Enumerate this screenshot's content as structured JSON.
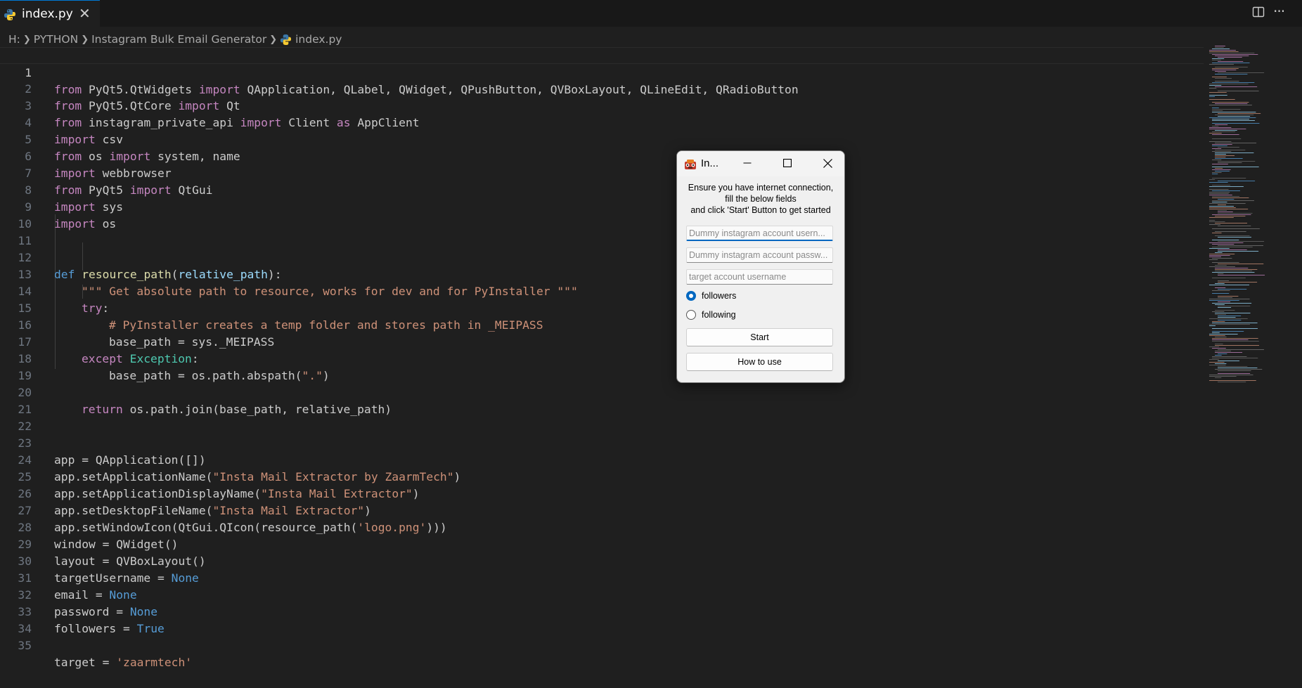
{
  "tab": {
    "filename": "index.py",
    "close_glyph": "✕"
  },
  "titlebar": {
    "split_icon": "split-editor-icon",
    "more_glyph": "···"
  },
  "breadcrumb": {
    "items": [
      "H:",
      "PYTHON",
      "Instagram Bulk Email Generator"
    ],
    "file": "index.py"
  },
  "editor": {
    "current_line": 1,
    "line_numbers": [
      "1",
      "2",
      "3",
      "4",
      "5",
      "6",
      "7",
      "8",
      "9",
      "10",
      "11",
      "12",
      "13",
      "14",
      "15",
      "16",
      "17",
      "18",
      "19",
      "20",
      "21",
      "22",
      "23",
      "24",
      "25",
      "26",
      "27",
      "28",
      "29",
      "30",
      "31",
      "32",
      "33",
      "34",
      "35"
    ]
  },
  "code": {
    "l1": {
      "kw1": "from",
      "t1": " PyQt5.QtWidgets ",
      "kw2": "import",
      "t2": " QApplication, QLabel, QWidget, QPushButton, QVBoxLayout, QLineEdit, QRadioButton"
    },
    "l2": {
      "kw1": "from",
      "t1": " PyQt5.QtCore ",
      "kw2": "import",
      "t2": " Qt"
    },
    "l3": {
      "kw1": "from",
      "t1": " instagram_private_api ",
      "kw2": "import",
      "t2": " Client ",
      "kw3": "as",
      "t3": " AppClient"
    },
    "l4": {
      "kw1": "import",
      "t1": " csv"
    },
    "l5": {
      "kw1": "from",
      "t1": " os ",
      "kw2": "import",
      "t2": " system, name"
    },
    "l6": {
      "kw1": "import",
      "t1": " webbrowser"
    },
    "l7": {
      "kw1": "from",
      "t1": " PyQt5 ",
      "kw2": "import",
      "t2": " QtGui"
    },
    "l8": {
      "kw1": "import",
      "t1": " sys"
    },
    "l9": {
      "kw1": "import",
      "t1": " os"
    },
    "l12": {
      "kw1": "def",
      "t0": " ",
      "fn": "resource_path",
      "t1": "(",
      "param": "relative_path",
      "t2": "):"
    },
    "l13": {
      "str": "\"\"\" Get absolute path to resource, works for dev and for PyInstaller \"\"\""
    },
    "l14": {
      "kw1": "try",
      "t1": ":"
    },
    "l15": {
      "cmt": "# PyInstaller creates a temp folder and stores path in _MEIPASS"
    },
    "l16": {
      "t1": "base_path = sys._MEIPASS"
    },
    "l17": {
      "kw1": "except",
      "t0": " ",
      "cls": "Exception",
      "t1": ":"
    },
    "l18": {
      "t1": "base_path = os.path.abspath(",
      "str": "\".\"",
      "t2": ")"
    },
    "l20": {
      "kw1": "return",
      "t1": " os.path.join(base_path, relative_path)"
    },
    "l23": {
      "t1": "app = QApplication([])"
    },
    "l24": {
      "t1": "app.setApplicationName(",
      "str": "\"Insta Mail Extractor by ZaarmTech\"",
      "t2": ")"
    },
    "l25": {
      "t1": "app.setApplicationDisplayName(",
      "str": "\"Insta Mail Extractor\"",
      "t2": ")"
    },
    "l26": {
      "t1": "app.setDesktopFileName(",
      "str": "\"Insta Mail Extractor\"",
      "t2": ")"
    },
    "l27": {
      "t1": "app.setWindowIcon(QtGui.QIcon(resource_path(",
      "str": "'logo.png'",
      "t2": ")))"
    },
    "l28": {
      "t1": "window = QWidget()"
    },
    "l29": {
      "t1": "layout = QVBoxLayout()"
    },
    "l30": {
      "t1": "targetUsername = ",
      "const": "None"
    },
    "l31": {
      "t1": "email = ",
      "const": "None"
    },
    "l32": {
      "t1": "password = ",
      "const": "None"
    },
    "l33": {
      "t1": "followers = ",
      "const": "True"
    },
    "l35": {
      "t1": "target = ",
      "str": "'zaarmtech'"
    }
  },
  "qt_window": {
    "title": "In...",
    "minimize_glyph": "─",
    "close_glyph": "✕",
    "message_lines": [
      "Ensure you have internet connection,",
      "fill the below fields",
      "and click 'Start' Button to get started"
    ],
    "username_placeholder": "Dummy instagram account usern...",
    "password_placeholder": "Dummy instagram account passw...",
    "target_placeholder": "target account username",
    "radio_followers": "followers",
    "radio_following": "following",
    "selected_radio": "followers",
    "start_button": "Start",
    "howto_button": "How to use"
  },
  "colors": {
    "editor_bg": "#1f1f1f",
    "keyword": "#c586c0",
    "keyword_blue": "#569cd6",
    "string": "#ce9178",
    "class": "#4ec9b0",
    "function": "#dcdcaa",
    "param": "#9cdcfe",
    "accent": "#0067c0"
  }
}
